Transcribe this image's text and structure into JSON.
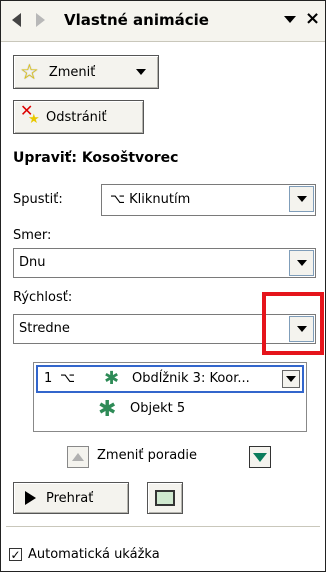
{
  "header": {
    "title": "Vlastné animácie"
  },
  "toolbar": {
    "change_label": "Zmeniť",
    "remove_label": "Odstrániť"
  },
  "section": {
    "title": "Upraviť: Kosoštvorec"
  },
  "start": {
    "label": "Spustiť:",
    "value": "Kliknutím"
  },
  "direction": {
    "label": "Smer:",
    "value": "Dnu"
  },
  "speed": {
    "label": "Rýchlosť:",
    "value": "Stredne"
  },
  "animation_list": {
    "items": [
      {
        "number": "1",
        "text": "Obdĺžnik 3: Koor..."
      },
      {
        "number": "",
        "text": "Objekt 5"
      }
    ]
  },
  "reorder": {
    "label": "Zmeniť poradie"
  },
  "play": {
    "label": "Prehrať"
  },
  "autopreview": {
    "label": "Automatická ukážka",
    "checked": true
  },
  "colors": {
    "highlight": "#e5141b",
    "selection_border": "#3366cc",
    "effect_icon": "#2e8b57"
  }
}
